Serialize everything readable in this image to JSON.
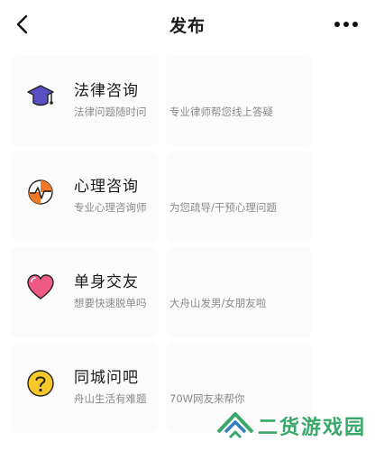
{
  "header": {
    "title": "发布",
    "back_icon": "chevron-left-icon",
    "more_icon": "more-horizontal-icon"
  },
  "services": [
    {
      "name": "法律咨询",
      "desc_left": "法律问题随时问",
      "desc_right": "专业律师帮您线上答疑",
      "icon": "graduation-cap-icon",
      "color": "#5b4fc4"
    },
    {
      "name": "心理咨询",
      "desc_left": "专业心理咨询师",
      "desc_right": "为您疏导/干预心理问题",
      "icon": "heartbeat-chart-icon",
      "color": "#f07a2a"
    },
    {
      "name": "单身交友",
      "desc_left": "想要快速脱单吗",
      "desc_right": "大舟山发男/女朋友啦",
      "icon": "heart-icon",
      "color": "#f05a86"
    },
    {
      "name": "同城问吧",
      "desc_left": "舟山生活有难题",
      "desc_right": "70W网友来帮你",
      "icon": "question-icon",
      "color": "#f7c928"
    }
  ],
  "watermark": {
    "text": "二货游戏园",
    "icon": "logo-icon",
    "color": "#3aa86a"
  }
}
